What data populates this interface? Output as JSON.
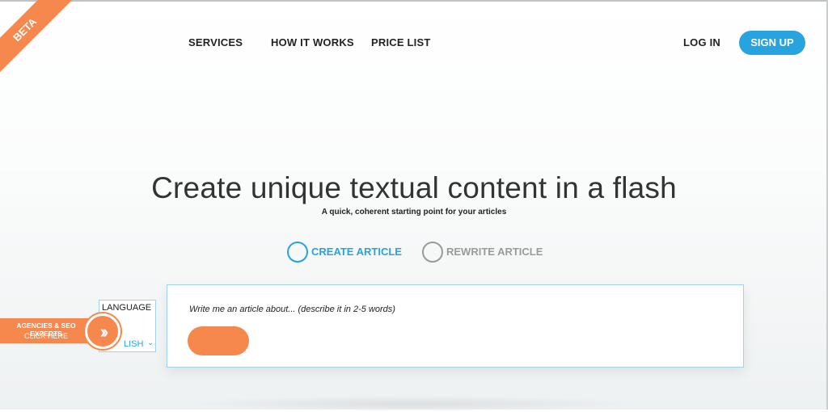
{
  "badge": {
    "label": "BETA"
  },
  "nav": {
    "services": "SERVICES",
    "how_it_works": "HOW IT WORKS",
    "price_list": "PRICE LIST",
    "login": "LOG IN",
    "signup": "SIGN UP"
  },
  "hero": {
    "title": "Create unique textual content in a flash",
    "subtitle": "A quick, coherent starting point for your articles"
  },
  "modes": {
    "create": "CREATE ARTICLE",
    "rewrite": "REWRITE ARTICLE",
    "selected": "create"
  },
  "language": {
    "title": "LANGUAGE",
    "value": "LISH",
    "chevron_icon": "chevron-down-icon"
  },
  "agencies": {
    "line1": "AGENCIES & SEO EXPERTS",
    "line2": "CLICK HERE",
    "icon": "double-chevron-right-icon"
  },
  "article": {
    "prompt": "Write me an article about... (describe it in 2-5 words)"
  },
  "colors": {
    "accent_blue": "#27a3df",
    "accent_orange": "#f6884e"
  }
}
